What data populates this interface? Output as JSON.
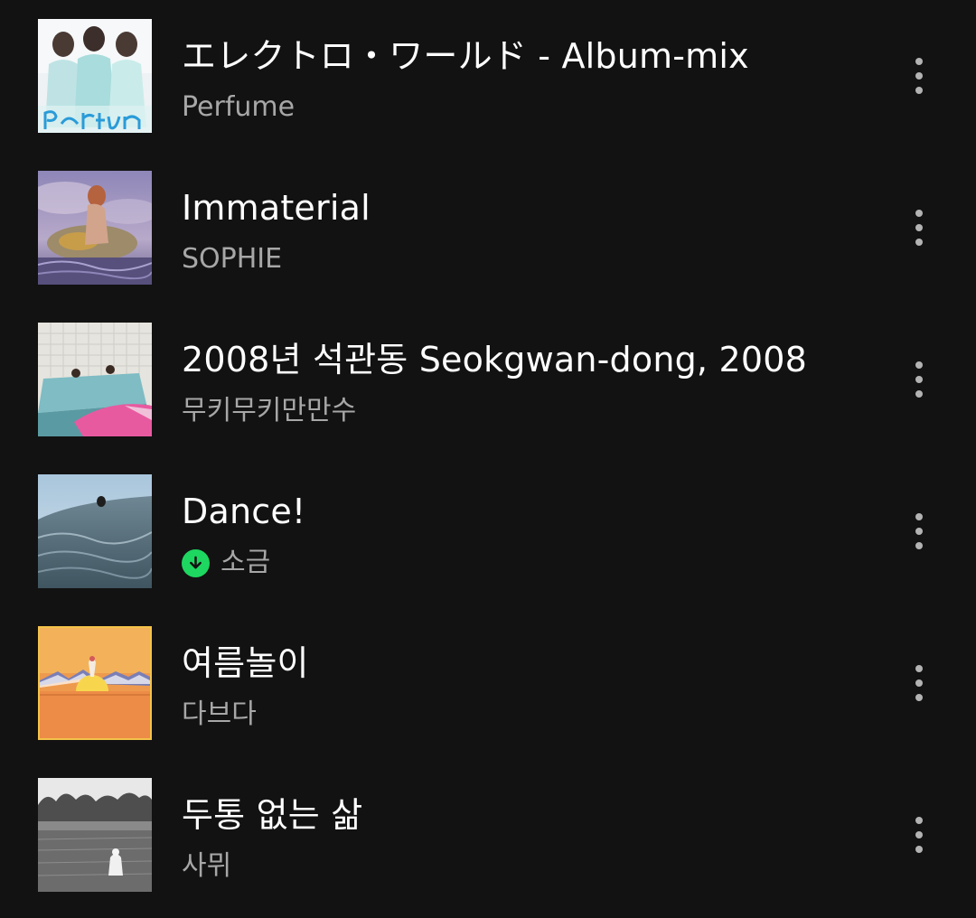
{
  "tracks": [
    {
      "title": "エレクトロ・ワールド - Album-mix",
      "artist": "Perfume",
      "downloaded": false,
      "cover_icon": "perfume-album-cover"
    },
    {
      "title": "Immaterial",
      "artist": "SOPHIE",
      "downloaded": false,
      "cover_icon": "sophie-album-cover"
    },
    {
      "title": "2008년 석관동 Seokgwan-dong, 2008",
      "artist": "무키무키만만수",
      "downloaded": false,
      "cover_icon": "pool-album-cover"
    },
    {
      "title": "Dance!",
      "artist": "소금",
      "downloaded": true,
      "cover_icon": "sea-album-cover"
    },
    {
      "title": "여름놀이",
      "artist": "다브다",
      "downloaded": false,
      "cover_icon": "sunset-album-cover"
    },
    {
      "title": "두통 없는 삶",
      "artist": "사뮈",
      "downloaded": false,
      "cover_icon": "field-album-cover"
    }
  ],
  "colors": {
    "background": "#121212",
    "title": "#ffffff",
    "subtitle": "#a7a7a7",
    "download_badge": "#1ed760",
    "more_dots": "#b3b3b3"
  },
  "icons": {
    "download": "download-arrow-icon",
    "more": "more-options-vertical-dots-icon"
  }
}
